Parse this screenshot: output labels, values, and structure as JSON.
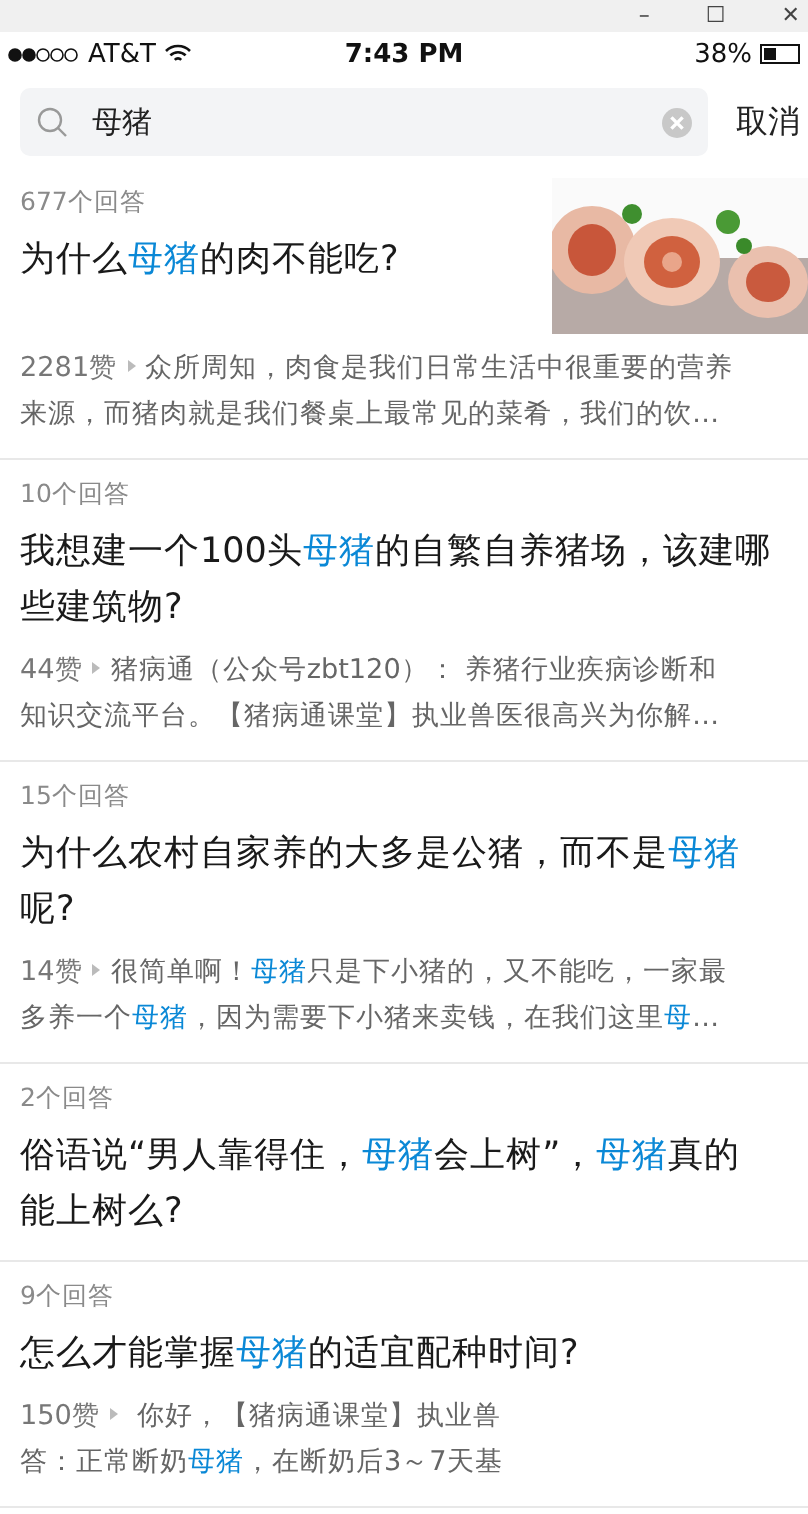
{
  "window_controls": [
    "–",
    "☐",
    "✕"
  ],
  "status_bar": {
    "carrier": "AT&T",
    "time": "7:43 PM",
    "battery": "38%"
  },
  "search": {
    "value": "母猪",
    "cancel": "取消"
  },
  "results": [
    {
      "answers": "677个回答",
      "title": [
        [
          {
            "text": "为什么"
          },
          {
            "text": "母猪",
            "highlight": true
          },
          {
            "text": "的肉不能吃?"
          }
        ]
      ],
      "media": {
        "kind": "picture"
      },
      "likes": "2281赞",
      "excerpt": [
        [
          {
            "text": "众所周知，肉食是我们日常生活中很重要的营养"
          }
        ],
        [
          {
            "text": "来源，而猪肉就是我们餐桌上最常见的菜肴，我们的饮…"
          }
        ]
      ]
    },
    {
      "answers": "10个回答",
      "title": [
        [
          {
            "text": "我想建一个100头"
          },
          {
            "text": "母猪",
            "highlight": true
          },
          {
            "text": "的自繁自养猪场，该建哪"
          }
        ],
        [
          {
            "text": "些建筑物?"
          }
        ]
      ],
      "likes": "44赞",
      "excerpt": [
        [
          {
            "text": "猪病通（公众号zbt120）： 养猪行业疾病诊断和"
          }
        ],
        [
          {
            "text": "知识交流平台。【猪病通课堂】执业兽医很高兴为你解…"
          }
        ]
      ]
    },
    {
      "answers": "15个回答",
      "title": [
        [
          {
            "text": "为什么农村自家养的大多是公猪，而不是"
          },
          {
            "text": "母猪",
            "highlight": true
          }
        ],
        [
          {
            "text": "呢?"
          }
        ]
      ],
      "likes": "14赞",
      "excerpt": [
        [
          {
            "text": "很简单啊！"
          },
          {
            "text": "母猪",
            "highlight": true
          },
          {
            "text": "只是下小猪的，又不能吃，一家最"
          }
        ],
        [
          {
            "text": "多养一个"
          },
          {
            "text": "母猪",
            "highlight": true
          },
          {
            "text": "，因为需要下小猪来卖钱，在我们这里"
          },
          {
            "text": "母",
            "highlight": true
          },
          {
            "text": "…"
          }
        ]
      ]
    },
    {
      "answers": "2个回答",
      "title": [
        [
          {
            "text": "俗语说“男人靠得住，"
          },
          {
            "text": "母猪",
            "highlight": true
          },
          {
            "text": "会上树”，"
          },
          {
            "text": "母猪",
            "highlight": true
          },
          {
            "text": "真的"
          }
        ],
        [
          {
            "text": "能上树么?"
          }
        ]
      ]
    },
    {
      "answers": "9个回答",
      "title": [
        [
          {
            "text": "怎么才能掌握"
          },
          {
            "text": "母猪",
            "highlight": true
          },
          {
            "text": "的适宜配种时间?"
          }
        ]
      ],
      "likes": "150赞",
      "excerpt": [
        [
          {
            "text": " 你好，【猪病通课堂】执业兽"
          }
        ],
        [
          {
            "text": "答：正常断奶"
          },
          {
            "text": "母猪",
            "highlight": true
          },
          {
            "text": "，在断奶后3～7天基"
          }
        ]
      ]
    }
  ]
}
